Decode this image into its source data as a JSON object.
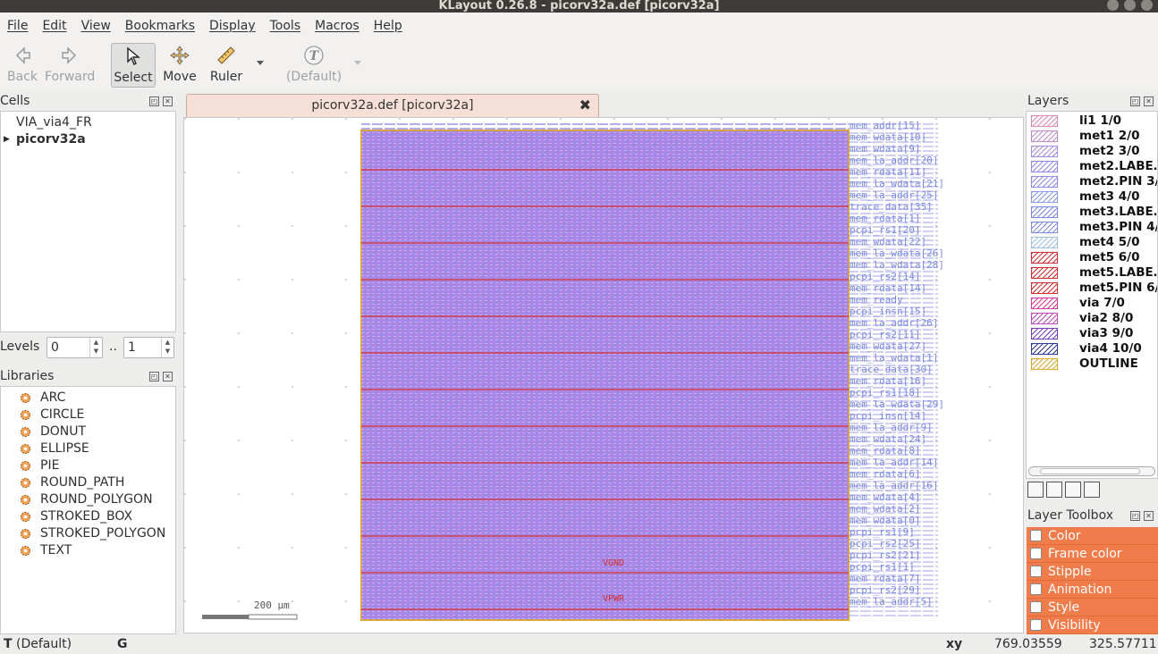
{
  "window": {
    "title": "KLayout 0.26.8 - picorv32a.def [picorv32a]"
  },
  "menu": [
    "File",
    "Edit",
    "View",
    "Bookmarks",
    "Display",
    "Tools",
    "Macros",
    "Help"
  ],
  "toolbar": {
    "back": "Back",
    "forward": "Forward",
    "select": "Select",
    "move": "Move",
    "ruler": "Ruler",
    "default_text": "(Default)",
    "text_glyph": "T"
  },
  "cells": {
    "title": "Cells",
    "items": [
      "VIA_via4_FR",
      "picorv32a"
    ]
  },
  "levels": {
    "label": "Levels",
    "from": "0",
    "sep": "..",
    "to": "1"
  },
  "libraries": {
    "title": "Libraries",
    "items": [
      "ARC",
      "CIRCLE",
      "DONUT",
      "ELLIPSE",
      "PIE",
      "ROUND_PATH",
      "ROUND_POLYGON",
      "STROKED_BOX",
      "STROKED_POLYGON",
      "TEXT"
    ]
  },
  "document": {
    "tab_label": "picorv32a.def [picorv32a]",
    "scale_label": "200 µm",
    "net_labels": [
      "VGND",
      "VPWR"
    ],
    "pin_labels": [
      "mem_addr[15]",
      "mem_wdata[10]",
      "mem_wdata[9]",
      "mem_la_addr[20]",
      "mem_rdata[11]",
      "mem_la_wdata[21]",
      "mem_la_addr[25]",
      "trace_data[35]",
      "mem_rdata[1]",
      "pcpi_rs1[20]",
      "mem_wdata[22]",
      "mem_la_wdata[26]",
      "mem_la_wdata[28]",
      "pcpi_rs2[14]",
      "mem_rdata[14]",
      "mem_ready",
      "pcpi_insn[15]",
      "mem_la_addr[26]",
      "pcpi_rs2[11]",
      "mem_wdata[27]",
      "mem_la_wdata[1]",
      "trace_data[30]",
      "mem_rdata[16]",
      "pcpi_rs1[18]",
      "mem_la_wdata[29]",
      "pcpi_insn[14]",
      "mem_la_addr[9]",
      "mem_wdata[24]",
      "mem_rdata[8]",
      "mem_la_addr[14]",
      "mem_rdata[6]",
      "mem_la_addr[16]",
      "mem_wdata[4]",
      "mem_wdata[2]",
      "mem_wdata[0]",
      "pcpi_rs1[9]",
      "pcpi_rs2[25]",
      "pcpi_rs2[21]",
      "pcpi_rs1[1]",
      "mem_rdata[7]",
      "pcpi_rs2[29]",
      "mem_la_addr[5]"
    ]
  },
  "layers": {
    "title": "Layers",
    "items": [
      {
        "name": "li1 1/0",
        "color": "#e58ab0"
      },
      {
        "name": "met1 2/0",
        "color": "#c48ad6"
      },
      {
        "name": "met2 3/0",
        "color": "#a58be8"
      },
      {
        "name": "met2.LABE…",
        "color": "#8c8ce8"
      },
      {
        "name": "met2.PIN 3/2",
        "color": "#8c8ce8"
      },
      {
        "name": "met3 4/0",
        "color": "#8c9be8"
      },
      {
        "name": "met3.LABE…",
        "color": "#7c8ae0"
      },
      {
        "name": "met3.PIN 4/2",
        "color": "#7c8ae0"
      },
      {
        "name": "met4 5/0",
        "color": "#9fc0e6"
      },
      {
        "name": "met5 6/0",
        "color": "#d43030"
      },
      {
        "name": "met5.LABE…",
        "color": "#d43030"
      },
      {
        "name": "met5.PIN 6/2",
        "color": "#d43030"
      },
      {
        "name": "via 7/0",
        "color": "#d43a9c"
      },
      {
        "name": "via2 8/0",
        "color": "#c04ac0"
      },
      {
        "name": "via3 9/0",
        "color": "#7a40c0"
      },
      {
        "name": "via4 10/0",
        "color": "#303a9a"
      },
      {
        "name": "OUTLINE",
        "color": "#e0a830"
      }
    ]
  },
  "layer_toolbox": {
    "title": "Layer Toolbox",
    "items": [
      "Color",
      "Frame color",
      "Stipple",
      "Animation",
      "Style",
      "Visibility"
    ]
  },
  "status": {
    "mode_glyph": "T",
    "mode": "(Default)",
    "g": "G",
    "coord_label": "xy",
    "x": "769.03559",
    "y": "325.57711"
  }
}
